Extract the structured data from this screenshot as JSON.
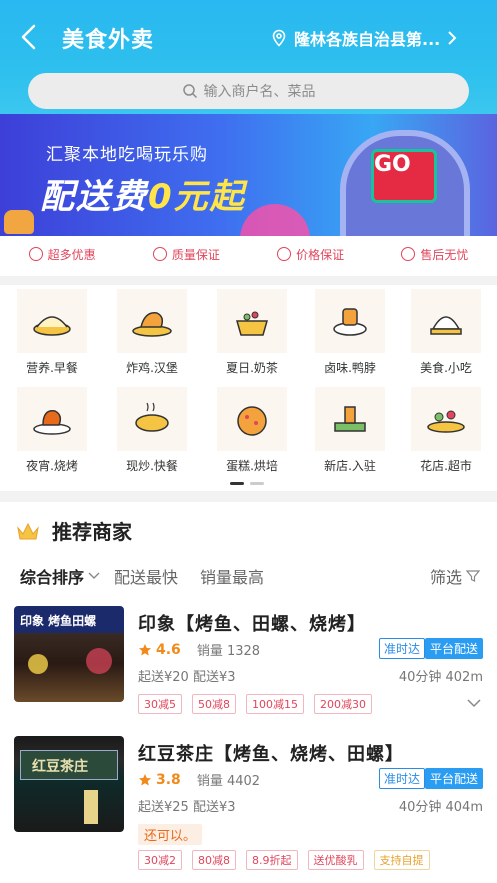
{
  "header": {
    "title": "美食外卖",
    "location": "隆林各族自治县第..."
  },
  "search": {
    "placeholder": "输入商户名、菜品"
  },
  "banner": {
    "line1": "汇聚本地吃喝玩乐购",
    "line2_a": "配送费",
    "line2_b": "0元起",
    "go": "GO"
  },
  "perks": [
    "超多优惠",
    "质量保证",
    "价格保证",
    "售后无忧"
  ],
  "categories": [
    {
      "label": "营养.早餐",
      "icon": "breakfast-icon"
    },
    {
      "label": "炸鸡.汉堡",
      "icon": "chicken-icon"
    },
    {
      "label": "夏日.奶茶",
      "icon": "milktea-icon"
    },
    {
      "label": "卤味.鸭脖",
      "icon": "braised-icon"
    },
    {
      "label": "美食.小吃",
      "icon": "snack-icon"
    },
    {
      "label": "夜宵.烧烤",
      "icon": "bbq-icon"
    },
    {
      "label": "现炒.快餐",
      "icon": "fastfood-icon"
    },
    {
      "label": "蛋糕.烘培",
      "icon": "cake-icon"
    },
    {
      "label": "新店.入驻",
      "icon": "newshop-icon"
    },
    {
      "label": "花店.超市",
      "icon": "flower-icon"
    }
  ],
  "recommend": {
    "title": "推荐商家",
    "sort": {
      "default": "综合排序",
      "fastest": "配送最快",
      "sales": "销量最高",
      "filter": "筛选"
    },
    "shops": [
      {
        "name": "印象【烤鱼、田螺、烧烤】",
        "score": "4.6",
        "sales": "销量 1328",
        "badge1": "准时达",
        "badge2": "平台配送",
        "fee": "起送¥20  配送¥3",
        "time": "40分钟 402m",
        "tags": [
          "30减5",
          "50减8",
          "100减15",
          "200减30"
        ],
        "sign_text": "印象  烤鱼田螺"
      },
      {
        "name": "红豆茶庄【烤鱼、烧烤、田螺】",
        "score": "3.8",
        "sales": "销量 4402",
        "badge1": "准时达",
        "badge2": "平台配送",
        "fee": "起送¥25  配送¥3",
        "time": "40分钟 404m",
        "note": "还可以。",
        "tags": [
          "30减2",
          "80减8",
          "8.9折起",
          "送优酸乳",
          "支持自提"
        ],
        "sign_text": "红豆茶庄"
      }
    ]
  },
  "colors": {
    "header": "#2ec0ee",
    "accent_red": "#e0465c",
    "badge_blue": "#2a9df2",
    "score_orange": "#f08b1b"
  }
}
